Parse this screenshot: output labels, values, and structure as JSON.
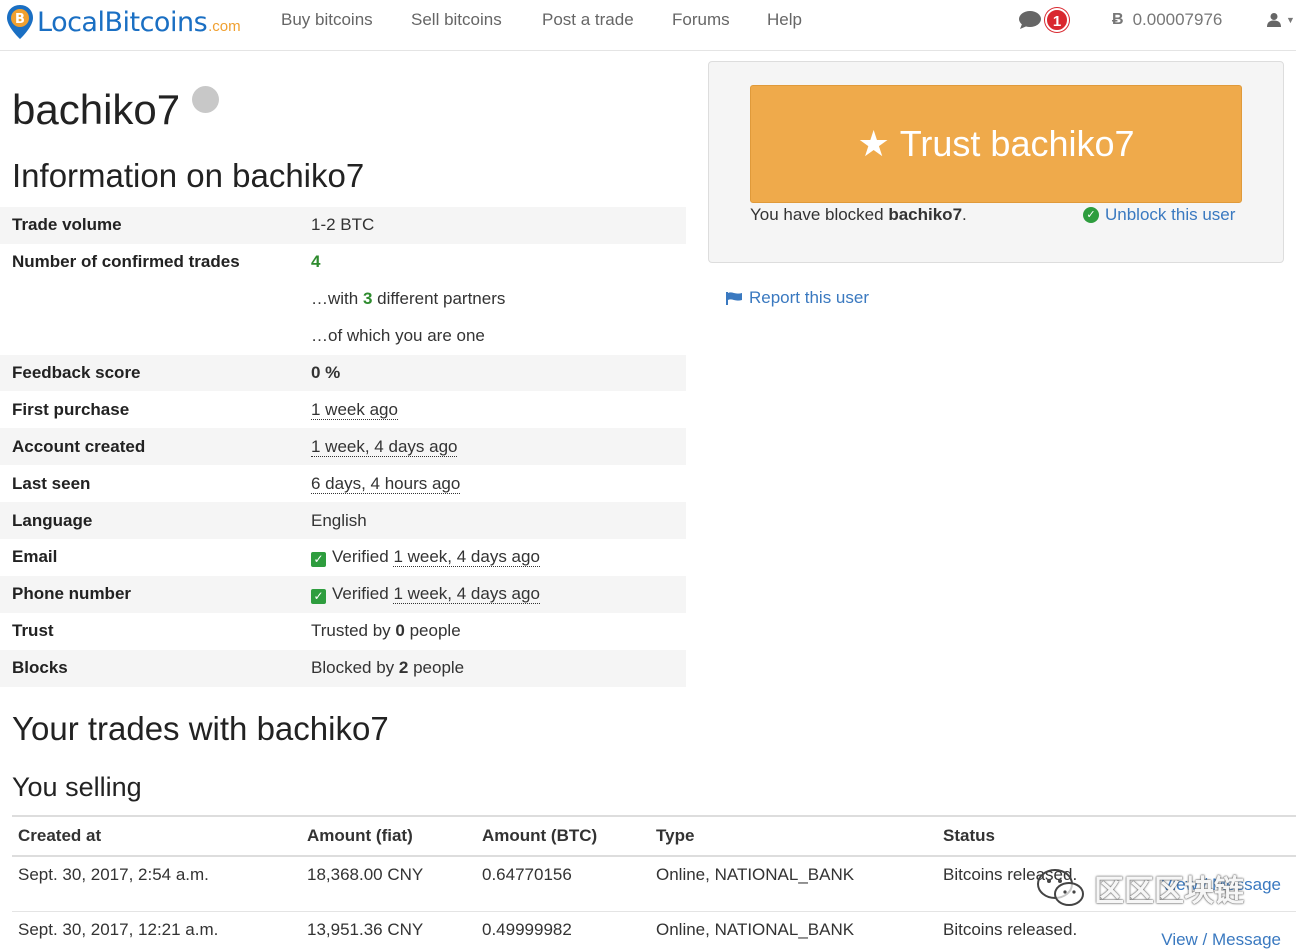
{
  "nav": {
    "logo_text": "LocalBitcoins",
    "logo_suffix": ".com",
    "links": [
      "Buy bitcoins",
      "Sell bitcoins",
      "Post a trade",
      "Forums",
      "Help"
    ],
    "notifications_count": "1",
    "balance": "0.00007976"
  },
  "profile": {
    "username": "bachiko7",
    "info_heading": "Information on bachiko7"
  },
  "info": {
    "trade_volume_label": "Trade volume",
    "trade_volume": "1-2 BTC",
    "confirmed_label": "Number of confirmed trades",
    "confirmed_count": "4",
    "partners_prefix": "…with ",
    "partners_count": "3",
    "partners_suffix": " different partners",
    "you_one": "…of which you are one",
    "feedback_label": "Feedback score",
    "feedback": "0 %",
    "first_purchase_label": "First purchase",
    "first_purchase": "1 week ago",
    "account_created_label": "Account created",
    "account_created": "1 week, 4 days ago",
    "last_seen_label": "Last seen",
    "last_seen": "6 days, 4 hours ago",
    "language_label": "Language",
    "language": "English",
    "email_label": "Email",
    "email_verified": "Verified",
    "email_when": "1 week, 4 days ago",
    "phone_label": "Phone number",
    "phone_verified": "Verified",
    "phone_when": "1 week, 4 days ago",
    "trust_label": "Trust",
    "trust_prefix": "Trusted by ",
    "trust_count": "0",
    "trust_suffix": " people",
    "blocks_label": "Blocks",
    "blocks_prefix": "Blocked by ",
    "blocks_count": "2",
    "blocks_suffix": " people"
  },
  "panel": {
    "trust_button": "Trust bachiko7",
    "blocked_prefix": "You have blocked ",
    "blocked_user": "bachiko7",
    "blocked_suffix": ".",
    "unblock": "Unblock this user",
    "report": "Report this user"
  },
  "trades": {
    "heading": "Your trades with bachiko7",
    "subheading": "You selling",
    "columns": [
      "Created at",
      "Amount (fiat)",
      "Amount (BTC)",
      "Type",
      "Status"
    ],
    "rows": [
      {
        "created": "Sept. 30, 2017, 2:54 a.m.",
        "fiat": "18,368.00 CNY",
        "btc": "0.64770156",
        "type": "Online, NATIONAL_BANK",
        "status": "Bitcoins released.",
        "actions": "View / Message"
      },
      {
        "created": "Sept. 30, 2017, 12:21 a.m.",
        "fiat": "13,951.36 CNY",
        "btc": "0.49999982",
        "type": "Online, NATIONAL_BANK",
        "status": "Bitcoins released.",
        "actions": "View / Message"
      }
    ]
  },
  "watermark": "区区区块链",
  "colors": {
    "brand": "#1a6fc3",
    "trust_button": "#efaa4b",
    "link": "#3a79c0",
    "verified": "#2e9d3e",
    "badge": "#d9282f"
  }
}
